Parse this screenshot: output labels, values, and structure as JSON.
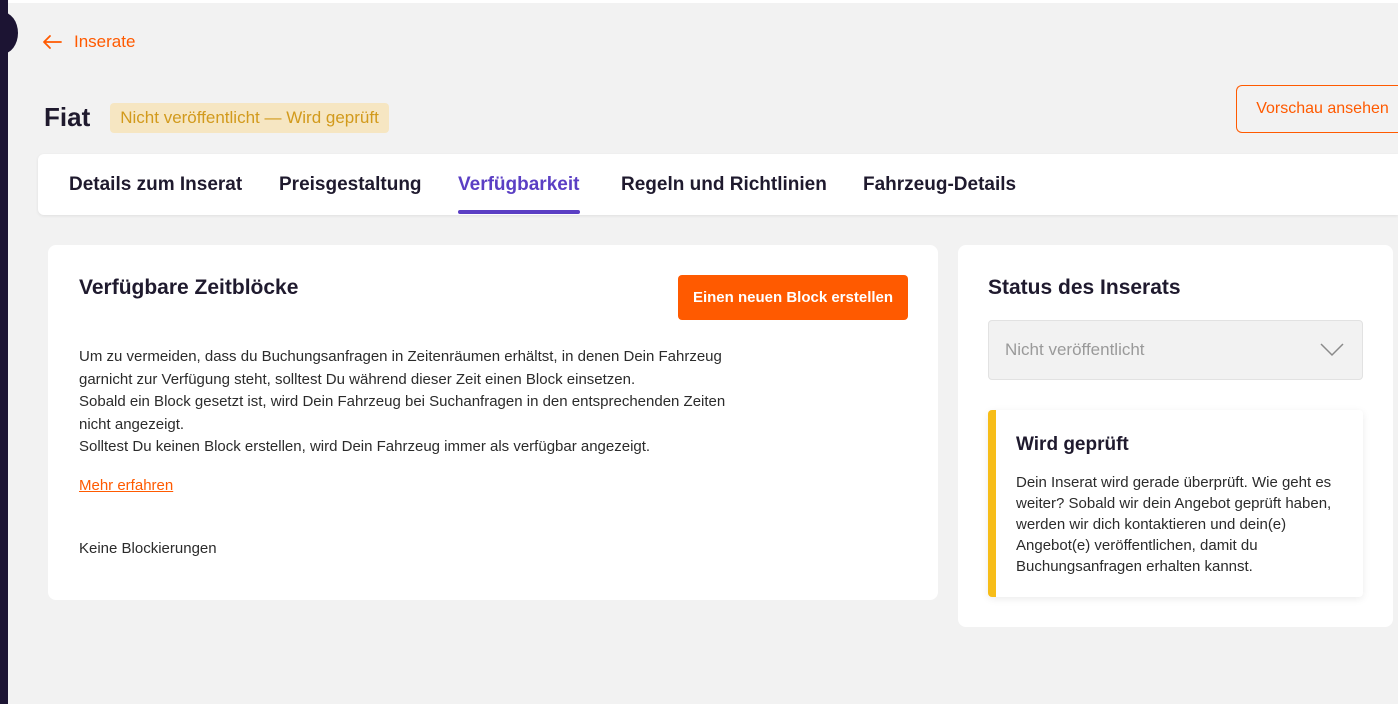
{
  "nav": {
    "back_label": "Inserate"
  },
  "header": {
    "title": "Fiat",
    "status_badge": "Nicht veröffentlicht — Wird geprüft",
    "preview_button": "Vorschau ansehen"
  },
  "tabs": [
    {
      "label": "Details zum Inserat",
      "active": false
    },
    {
      "label": "Preisgestaltung",
      "active": false
    },
    {
      "label": "Verfügbarkeit",
      "active": true
    },
    {
      "label": "Regeln und Richtlinien",
      "active": false
    },
    {
      "label": "Fahrzeug-Details",
      "active": false
    }
  ],
  "availability": {
    "title": "Verfügbare Zeitblöcke",
    "create_button": "Einen neuen Block erstellen",
    "description_lines": [
      "Um zu vermeiden, dass du Buchungsanfragen in Zeitenräumen erhältst, in denen Dein Fahrzeug",
      "garnicht zur Verfügung steht, solltest Du während dieser Zeit einen Block einsetzen.",
      "Sobald ein Block gesetzt ist, wird Dein Fahrzeug bei Suchanfragen in den entsprechenden Zeiten",
      "nicht angezeigt.",
      "Solltest Du keinen Block erstellen, wird Dein Fahrzeug immer als verfügbar angezeigt."
    ],
    "more_link": "Mehr erfahren",
    "empty_text": "Keine Blockierungen"
  },
  "status_panel": {
    "title": "Status des Inserats",
    "select_value": "Nicht veröffentlicht",
    "review_title": "Wird geprüft",
    "review_text": "Dein Inserat wird gerade überprüft. Wie geht es weiter? Sobald wir dein Angebot geprüft haben, werden wir dich kontaktieren und dein(e) Angebot(e) veröffentlichen, damit du Buchungsanfragen erhalten kannst."
  },
  "colors": {
    "accent": "#ff5a00",
    "active_tab": "#5b3fc4",
    "badge_bg": "#f6e6c2",
    "badge_text": "#d29a1c",
    "review_border": "#f7bd18"
  },
  "icons": {
    "back": "arrow-left-icon",
    "select": "chevron-down-icon"
  }
}
